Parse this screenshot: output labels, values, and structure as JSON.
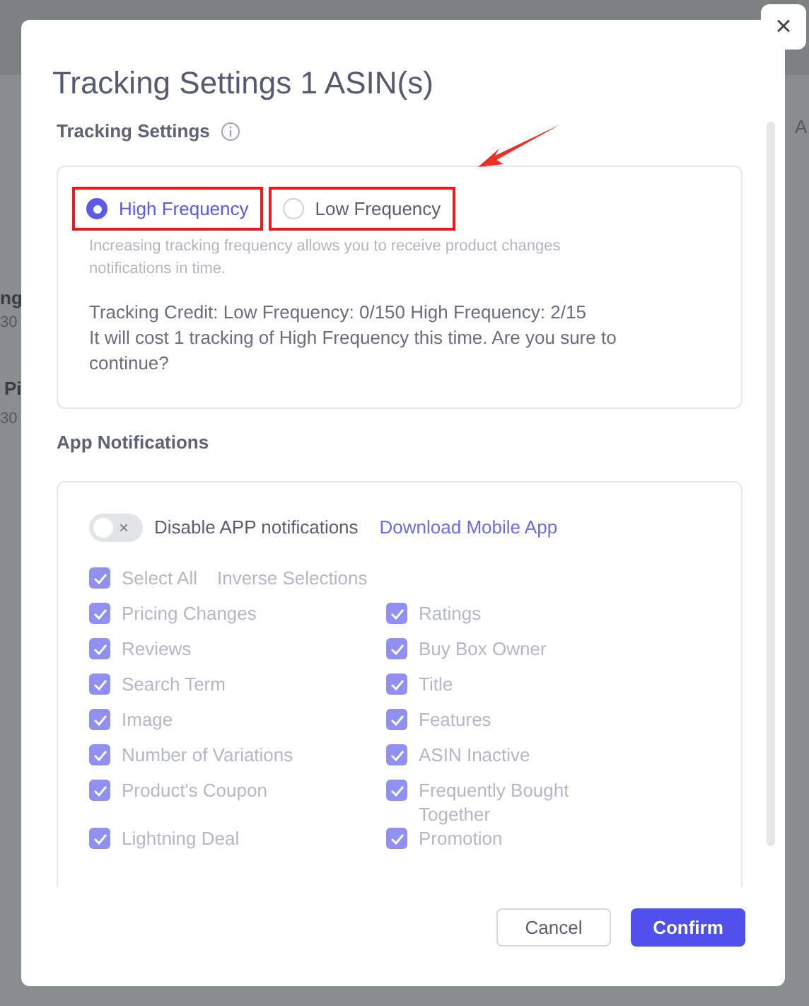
{
  "background": {
    "fragments": [
      {
        "text": "ng"
      },
      {
        "text": "30"
      },
      {
        "text": "Pi"
      },
      {
        "text": "30"
      }
    ],
    "header_fragment": "A"
  },
  "dialog": {
    "title": "Tracking Settings 1 ASIN(s)",
    "close": "×",
    "tracking": {
      "label": "Tracking Settings",
      "options": [
        {
          "label": "High Frequency",
          "selected": true,
          "highlighted": true
        },
        {
          "label": "Low Frequency",
          "selected": false,
          "highlighted": true
        }
      ],
      "hint": "Increasing tracking frequency allows you to receive product changes notifications in time.",
      "credit": "Tracking Credit: Low Frequency: 0/150 High Frequency: 2/15",
      "confirm_text": "It will cost 1 tracking of High Frequency this time. Are you sure to continue?"
    },
    "notifications": {
      "label": "App Notifications",
      "toggle": {
        "on": false,
        "label": "Disable APP notifications",
        "off_glyph": "×"
      },
      "link": "Download Mobile App",
      "select_all": {
        "label": "Select All",
        "checked": true
      },
      "inverse": "Inverse Selections",
      "disabled": true,
      "items": [
        {
          "label": "Pricing Changes",
          "checked": true
        },
        {
          "label": "Ratings",
          "checked": true
        },
        {
          "label": "Reviews",
          "checked": true
        },
        {
          "label": "Buy Box Owner",
          "checked": true
        },
        {
          "label": "Search Term",
          "checked": true
        },
        {
          "label": "Title",
          "checked": true
        },
        {
          "label": "Image",
          "checked": true
        },
        {
          "label": "Features",
          "checked": true
        },
        {
          "label": "Number of Variations",
          "checked": true
        },
        {
          "label": "ASIN Inactive",
          "checked": true
        },
        {
          "label": "Product's Coupon",
          "checked": true
        },
        {
          "label": "Frequently Bought Together",
          "checked": true
        },
        {
          "label": "Lightning Deal",
          "checked": true
        },
        {
          "label": "Promotion",
          "checked": true
        }
      ]
    },
    "buttons": [
      {
        "label": "Cancel",
        "kind": "secondary"
      },
      {
        "label": "Confirm",
        "kind": "primary"
      }
    ]
  }
}
